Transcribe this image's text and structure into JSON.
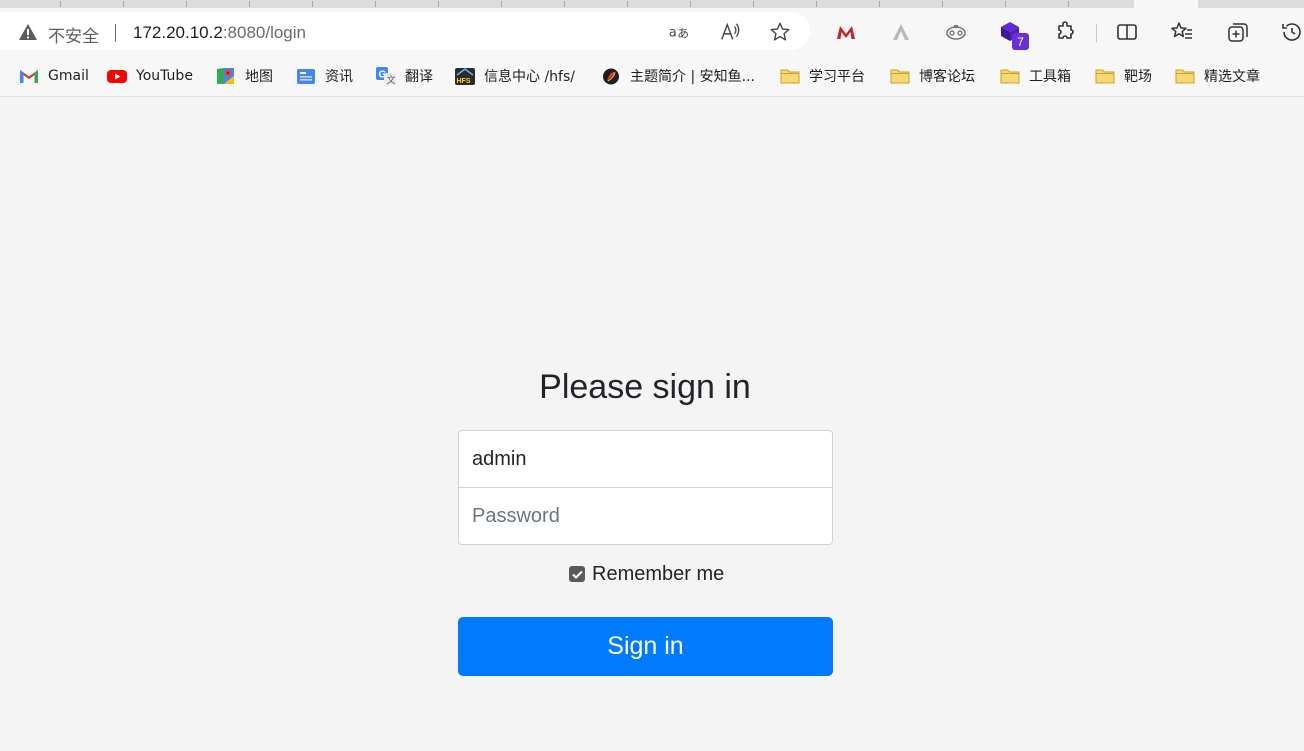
{
  "browser": {
    "security_label": "不安全",
    "url_host": "172.20.10.2",
    "url_rest": ":8080/login",
    "extension_badge": "7",
    "icons": [
      "warning-icon",
      "translate-icon",
      "read-aloud-icon",
      "favorite-star-icon",
      "extension-m-icon",
      "extension-a-icon",
      "extension-gamepad-icon",
      "extension-cube-icon",
      "extensions-puzzle-icon",
      "split-screen-icon",
      "favorites-icon",
      "collections-icon",
      "history-icon"
    ]
  },
  "bookmarks": [
    {
      "label": "Gmail",
      "icon": "gmail-icon"
    },
    {
      "label": "YouTube",
      "icon": "youtube-icon"
    },
    {
      "label": "地图",
      "icon": "maps-icon"
    },
    {
      "label": "资讯",
      "icon": "news-icon"
    },
    {
      "label": "翻译",
      "icon": "translate-icon"
    },
    {
      "label": "信息中心 /hfs/",
      "icon": "hfs-icon"
    },
    {
      "label": "主题简介 | 安知鱼...",
      "icon": "anzhiyu-icon"
    },
    {
      "label": "学习平台",
      "icon": "folder-icon"
    },
    {
      "label": "博客论坛",
      "icon": "folder-icon"
    },
    {
      "label": "工具箱",
      "icon": "folder-icon"
    },
    {
      "label": "靶场",
      "icon": "folder-icon"
    },
    {
      "label": "精选文章",
      "icon": "folder-icon"
    }
  ],
  "login": {
    "title": "Please sign in",
    "username_value": "admin",
    "password_placeholder": "Password",
    "remember_label": "Remember me",
    "remember_checked": true,
    "submit_label": "Sign in"
  },
  "colors": {
    "primary": "#007bff",
    "page_background": "#f4f4f4"
  }
}
